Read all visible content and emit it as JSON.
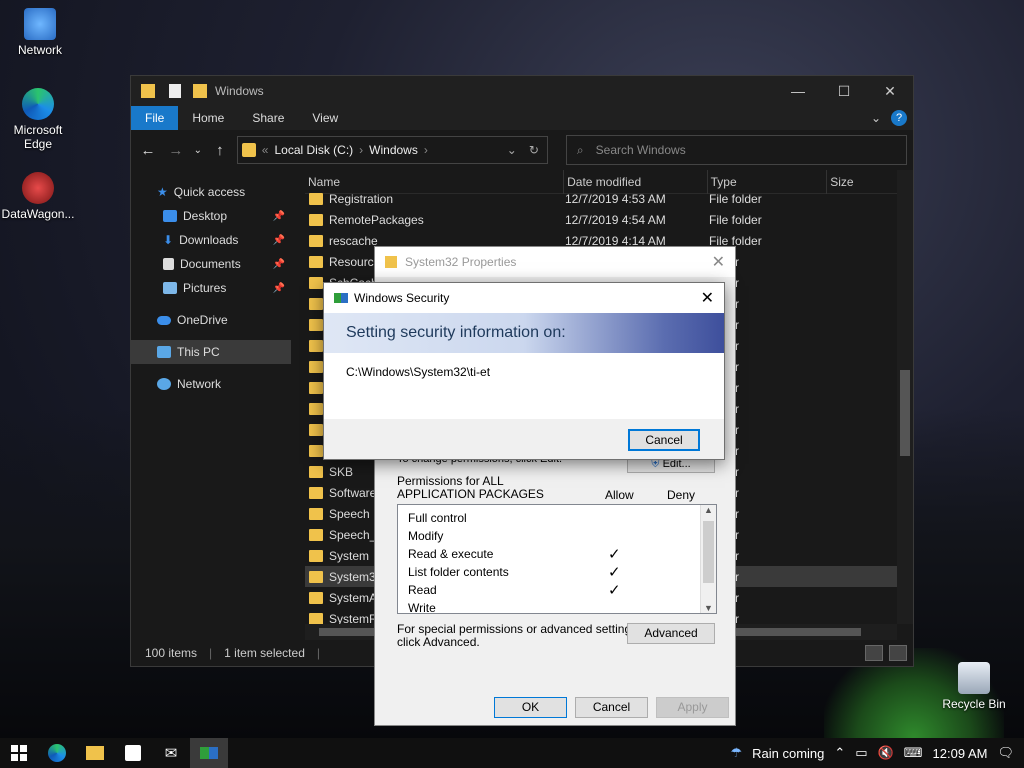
{
  "desktop": {
    "icons": [
      {
        "label": "Network"
      },
      {
        "label": "Microsoft\nEdge"
      },
      {
        "label": "DataWagon..."
      },
      {
        "label": "Recycle Bin"
      }
    ]
  },
  "explorer": {
    "title": "Windows",
    "tabs": [
      "File",
      "Home",
      "Share",
      "View"
    ],
    "address": {
      "root": "Local Disk (C:)",
      "current": "Windows"
    },
    "search_placeholder": "Search Windows",
    "nav": [
      {
        "label": "Quick access"
      },
      {
        "label": "Desktop"
      },
      {
        "label": "Downloads"
      },
      {
        "label": "Documents"
      },
      {
        "label": "Pictures"
      },
      {
        "label": "OneDrive"
      },
      {
        "label": "This PC"
      },
      {
        "label": "Network"
      }
    ],
    "columns": [
      "Name",
      "Date modified",
      "Type",
      "Size"
    ],
    "rows": [
      {
        "name": "Registration",
        "date": "12/7/2019 4:53 AM",
        "type": "File folder"
      },
      {
        "name": "RemotePackages",
        "date": "12/7/2019 4:54 AM",
        "type": "File folder"
      },
      {
        "name": "rescache",
        "date": "12/7/2019 4:14 AM",
        "type": "File folder"
      },
      {
        "name": "Resource",
        "date": "",
        "type": "folder"
      },
      {
        "name": "SchCach",
        "date": "",
        "type": "folder"
      },
      {
        "name": "",
        "date": "",
        "type": "folder"
      },
      {
        "name": "",
        "date": "",
        "type": "folder"
      },
      {
        "name": "",
        "date": "",
        "type": "folder"
      },
      {
        "name": "",
        "date": "",
        "type": "folder"
      },
      {
        "name": "",
        "date": "",
        "type": "folder"
      },
      {
        "name": "",
        "date": "",
        "type": "folder"
      },
      {
        "name": "",
        "date": "",
        "type": "folder"
      },
      {
        "name": "",
        "date": "",
        "type": "folder"
      },
      {
        "name": "SKB",
        "date": "",
        "type": "folder"
      },
      {
        "name": "Software",
        "date": "",
        "type": "folder"
      },
      {
        "name": "Speech",
        "date": "",
        "type": "folder"
      },
      {
        "name": "Speech_O",
        "date": "",
        "type": "folder"
      },
      {
        "name": "System",
        "date": "",
        "type": "folder"
      },
      {
        "name": "System32",
        "date": "",
        "type": "folder"
      },
      {
        "name": "SystemA",
        "date": "",
        "type": "folder"
      },
      {
        "name": "SystemR",
        "date": "",
        "type": "folder"
      }
    ],
    "status": {
      "items": "100 items",
      "selected": "1 item selected"
    }
  },
  "properties": {
    "title": "System32 Properties",
    "edit_hint": "To change permissions, click Edit.",
    "edit_label": "Edit...",
    "perm_for": "Permissions for ALL\nAPPLICATION PACKAGES",
    "allow": "Allow",
    "deny": "Deny",
    "permissions": [
      {
        "name": "Full control",
        "allow": ""
      },
      {
        "name": "Modify",
        "allow": ""
      },
      {
        "name": "Read & execute",
        "allow": "✓"
      },
      {
        "name": "List folder contents",
        "allow": "✓"
      },
      {
        "name": "Read",
        "allow": "✓"
      },
      {
        "name": "Write",
        "allow": ""
      }
    ],
    "special": "For special permissions or advanced settings,\nclick Advanced.",
    "advanced_label": "Advanced",
    "ok_label": "OK",
    "cancel_label": "Cancel",
    "apply_label": "Apply"
  },
  "security": {
    "title": "Windows Security",
    "heading": "Setting security information on:",
    "path": "C:\\Windows\\System32\\ti-et",
    "cancel_label": "Cancel"
  },
  "taskbar": {
    "weather": "Rain coming",
    "time": "12:09 AM"
  }
}
